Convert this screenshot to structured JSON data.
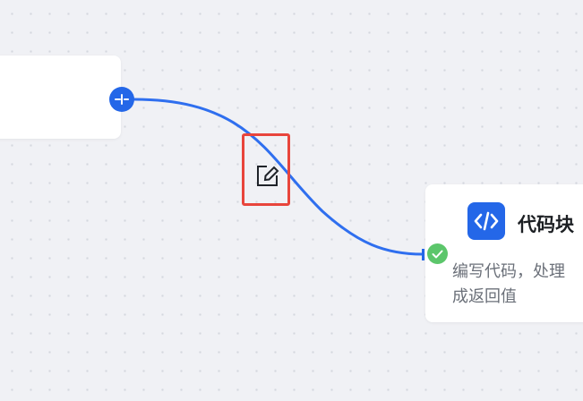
{
  "code_node": {
    "title": "代码块",
    "description": "编写代码，处理\n成返回值",
    "icon": "code-brackets-icon",
    "accent_color": "#2467e8"
  },
  "connection": {
    "color": "#2f6fef",
    "status": "success",
    "status_color": "#5cc66b"
  },
  "edit_action": {
    "icon": "edit-square-icon",
    "highlight_color": "#e8453c"
  }
}
